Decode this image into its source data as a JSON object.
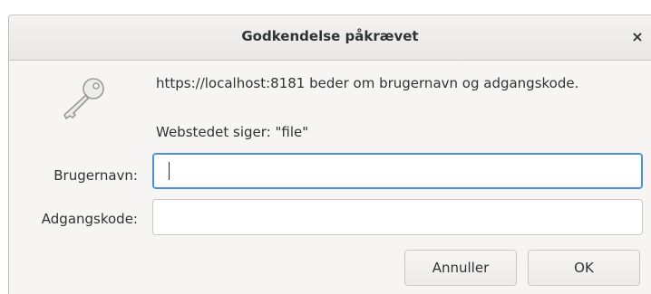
{
  "dialog": {
    "title": "Godkendelse påkrævet",
    "close_symbol": "×",
    "icon": "key-icon",
    "message": "https://localhost:8181 beder om brugernavn og adgangskode.",
    "realm_message": "Webstedet siger: \"file\""
  },
  "form": {
    "username_label": "Brugernavn:",
    "username_value": "",
    "password_label": "Adgangskode:",
    "password_value": ""
  },
  "buttons": {
    "cancel_label": "Annuller",
    "ok_label": "OK"
  },
  "colors": {
    "focus_border": "#4a90d9",
    "dialog_bg": "#f6f5f4",
    "text": "#2e3436"
  }
}
